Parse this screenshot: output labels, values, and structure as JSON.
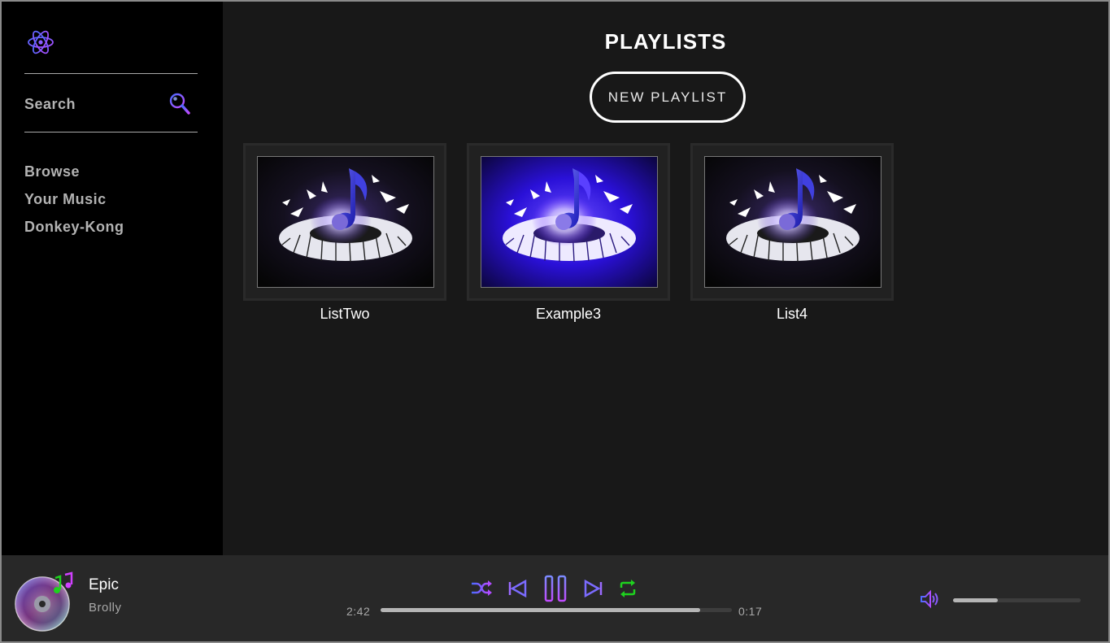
{
  "sidebar": {
    "search_label": "Search",
    "nav_items": [
      "Browse",
      "Your Music",
      "Donkey-Kong"
    ],
    "logo_icon": "atom-icon",
    "search_icon": "magnifier-icon"
  },
  "main": {
    "title": "PLAYLISTS",
    "new_playlist_label": "NEW PLAYLIST",
    "playlists": [
      {
        "name": "ListTwo",
        "cover_variant": "dark"
      },
      {
        "name": "Example3",
        "cover_variant": "blue"
      },
      {
        "name": "List4",
        "cover_variant": "dark"
      }
    ]
  },
  "player": {
    "song_title": "Epic",
    "artist": "Brolly",
    "elapsed": "2:42",
    "remaining": "0:17",
    "progress_fraction": 0.91,
    "volume_fraction": 0.35,
    "icons": [
      "shuffle-icon",
      "previous-icon",
      "pause-icon",
      "next-icon",
      "repeat-icon",
      "volume-icon"
    ],
    "colors": {
      "accent_purple": "#7b3fe4",
      "accent_blue": "#4a63e6",
      "repeat_green": "#1ed21e"
    }
  }
}
